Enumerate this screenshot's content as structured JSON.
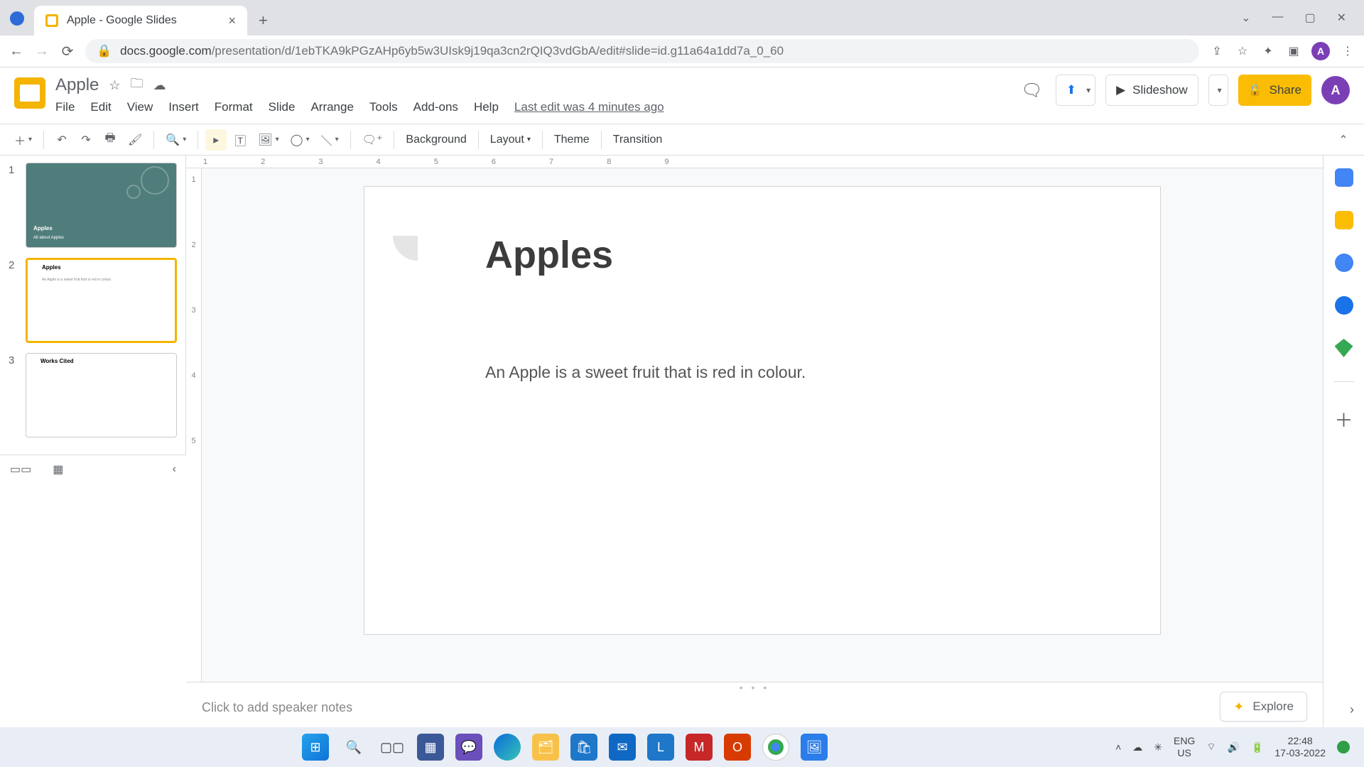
{
  "browser": {
    "tab_title": "Apple - Google Slides",
    "url_host": "docs.google.com",
    "url_path": "/presentation/d/1ebTKA9kPGzAHp6yb5w3UIsk9j19qa3cn2rQIQ3vdGbA/edit#slide=id.g11a64a1dd7a_0_60",
    "window_ctrls": {
      "min": "—",
      "max": "▢",
      "close": "✕",
      "tabs": "⌄"
    },
    "avatar_letter": "A"
  },
  "header": {
    "doc_title": "Apple",
    "menus": [
      "File",
      "Edit",
      "View",
      "Insert",
      "Format",
      "Slide",
      "Arrange",
      "Tools",
      "Add-ons",
      "Help"
    ],
    "last_edit": "Last edit was 4 minutes ago",
    "slideshow_label": "Slideshow",
    "share_label": "Share"
  },
  "toolbar": {
    "background": "Background",
    "layout": "Layout",
    "theme": "Theme",
    "transition": "Transition"
  },
  "ruler_h": "1        2        3        4        5        6        7        8        9",
  "ruler_v": [
    "1",
    "2",
    "3",
    "4",
    "5"
  ],
  "filmstrip": [
    {
      "num": "1",
      "title": "Apples",
      "sub": "All about Apples",
      "type": "title",
      "selected": false
    },
    {
      "num": "2",
      "title": "Apples",
      "sub": "An Apple is a sweet fruit that is red in colour.",
      "type": "body",
      "selected": true
    },
    {
      "num": "3",
      "title": "Works Cited",
      "sub": "",
      "type": "body",
      "selected": false
    }
  ],
  "canvas": {
    "title": "Apples",
    "body": "An Apple is a sweet fruit that is red in colour."
  },
  "notes_placeholder": "Click to add speaker notes",
  "explore_label": "Explore",
  "taskbar": {
    "lang1": "ENG",
    "lang2": "US",
    "time": "22:48",
    "date": "17-03-2022"
  }
}
